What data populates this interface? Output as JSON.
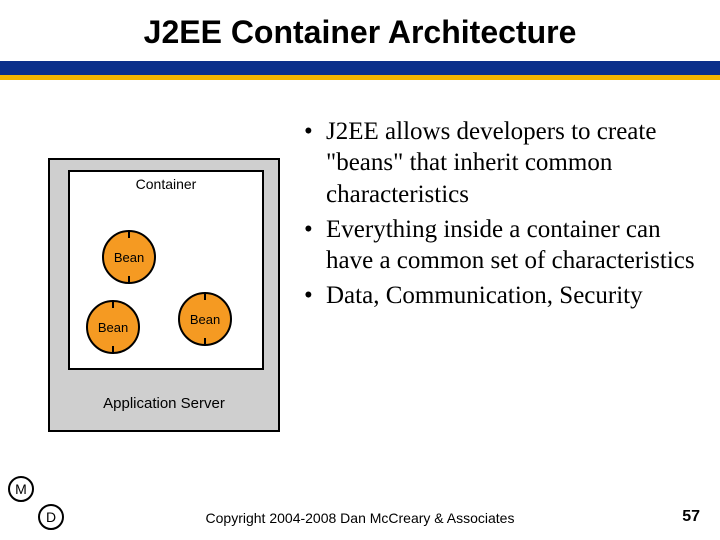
{
  "title": "J2EE Container Architecture",
  "diagram": {
    "container_label": "Container",
    "bean_label": "Bean",
    "appserver_label": "Application Server"
  },
  "bullets": [
    "J2EE allows developers to create \"beans\" that inherit common characteristics",
    "Everything inside a container can have a common set of characteristics",
    "Data, Communication, Security"
  ],
  "corners": {
    "m": "M",
    "d": "D"
  },
  "footer": "Copyright 2004-2008 Dan McCreary & Associates",
  "page_number": "57"
}
